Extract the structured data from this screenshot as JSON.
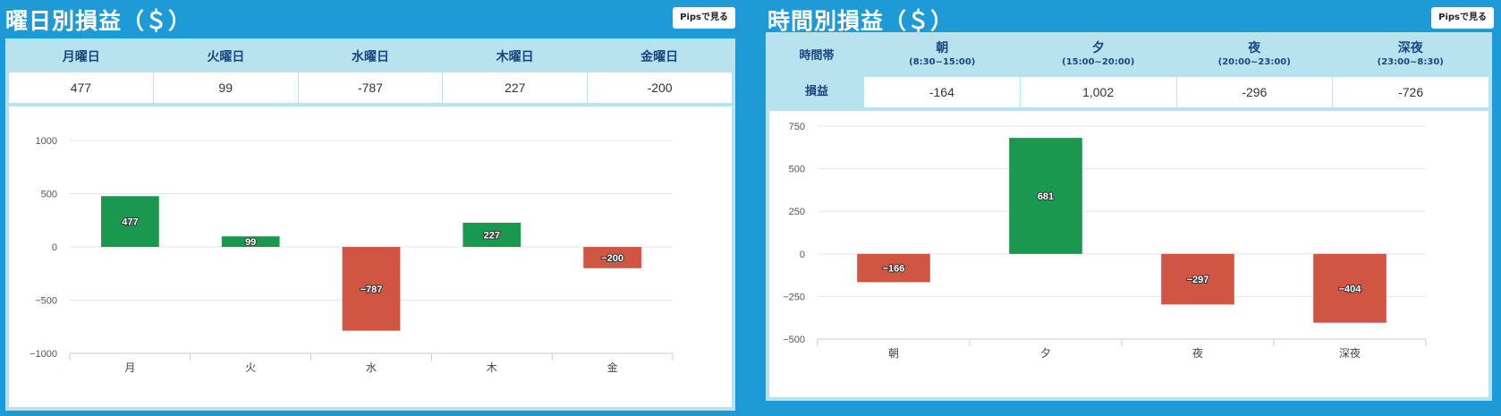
{
  "left": {
    "title": "曜日別損益（＄）",
    "pips_label": "Pipsで見る",
    "table": {
      "headers": [
        "月曜日",
        "火曜日",
        "水曜日",
        "木曜日",
        "金曜日"
      ],
      "values": [
        "477",
        "99",
        "-787",
        "227",
        "-200"
      ]
    }
  },
  "right": {
    "title": "時間別損益（＄）",
    "pips_label": "Pipsで見る",
    "table": {
      "header_label": "時間帯",
      "value_label": "損益",
      "headers": [
        {
          "name": "朝",
          "range": "(8:30~15:00)"
        },
        {
          "name": "夕",
          "range": "(15:00~20:00)"
        },
        {
          "name": "夜",
          "range": "(20:00~23:00)"
        },
        {
          "name": "深夜",
          "range": "(23:00~8:30)"
        }
      ],
      "values": [
        "-164",
        "1,002",
        "-296",
        "-726"
      ]
    }
  },
  "colors": {
    "background": "#1e9ad6",
    "positive": "#1a9850",
    "negative": "#d05542",
    "header_text": "#1a4780"
  },
  "chart_data": [
    {
      "type": "bar",
      "categories": [
        "月",
        "火",
        "水",
        "木",
        "金"
      ],
      "values": [
        477,
        99,
        -787,
        227,
        -200
      ],
      "data_labels": [
        "477",
        "99",
        "−787",
        "227",
        "−200"
      ],
      "yticks": [
        1000,
        500,
        0,
        -500,
        -1000
      ],
      "ytick_labels": [
        "1000",
        "500",
        "0",
        "−500",
        "−1000"
      ],
      "ylim": [
        -1000,
        1000
      ],
      "grid": true
    },
    {
      "type": "bar",
      "categories": [
        "朝",
        "夕",
        "夜",
        "深夜"
      ],
      "values": [
        -166,
        681,
        -297,
        -404
      ],
      "data_labels": [
        "−166",
        "681",
        "−297",
        "−404"
      ],
      "yticks": [
        750,
        500,
        250,
        0,
        -250,
        -500
      ],
      "ytick_labels": [
        "750",
        "500",
        "250",
        "0",
        "−250",
        "−500"
      ],
      "ylim": [
        -500,
        750
      ],
      "grid": true
    }
  ]
}
